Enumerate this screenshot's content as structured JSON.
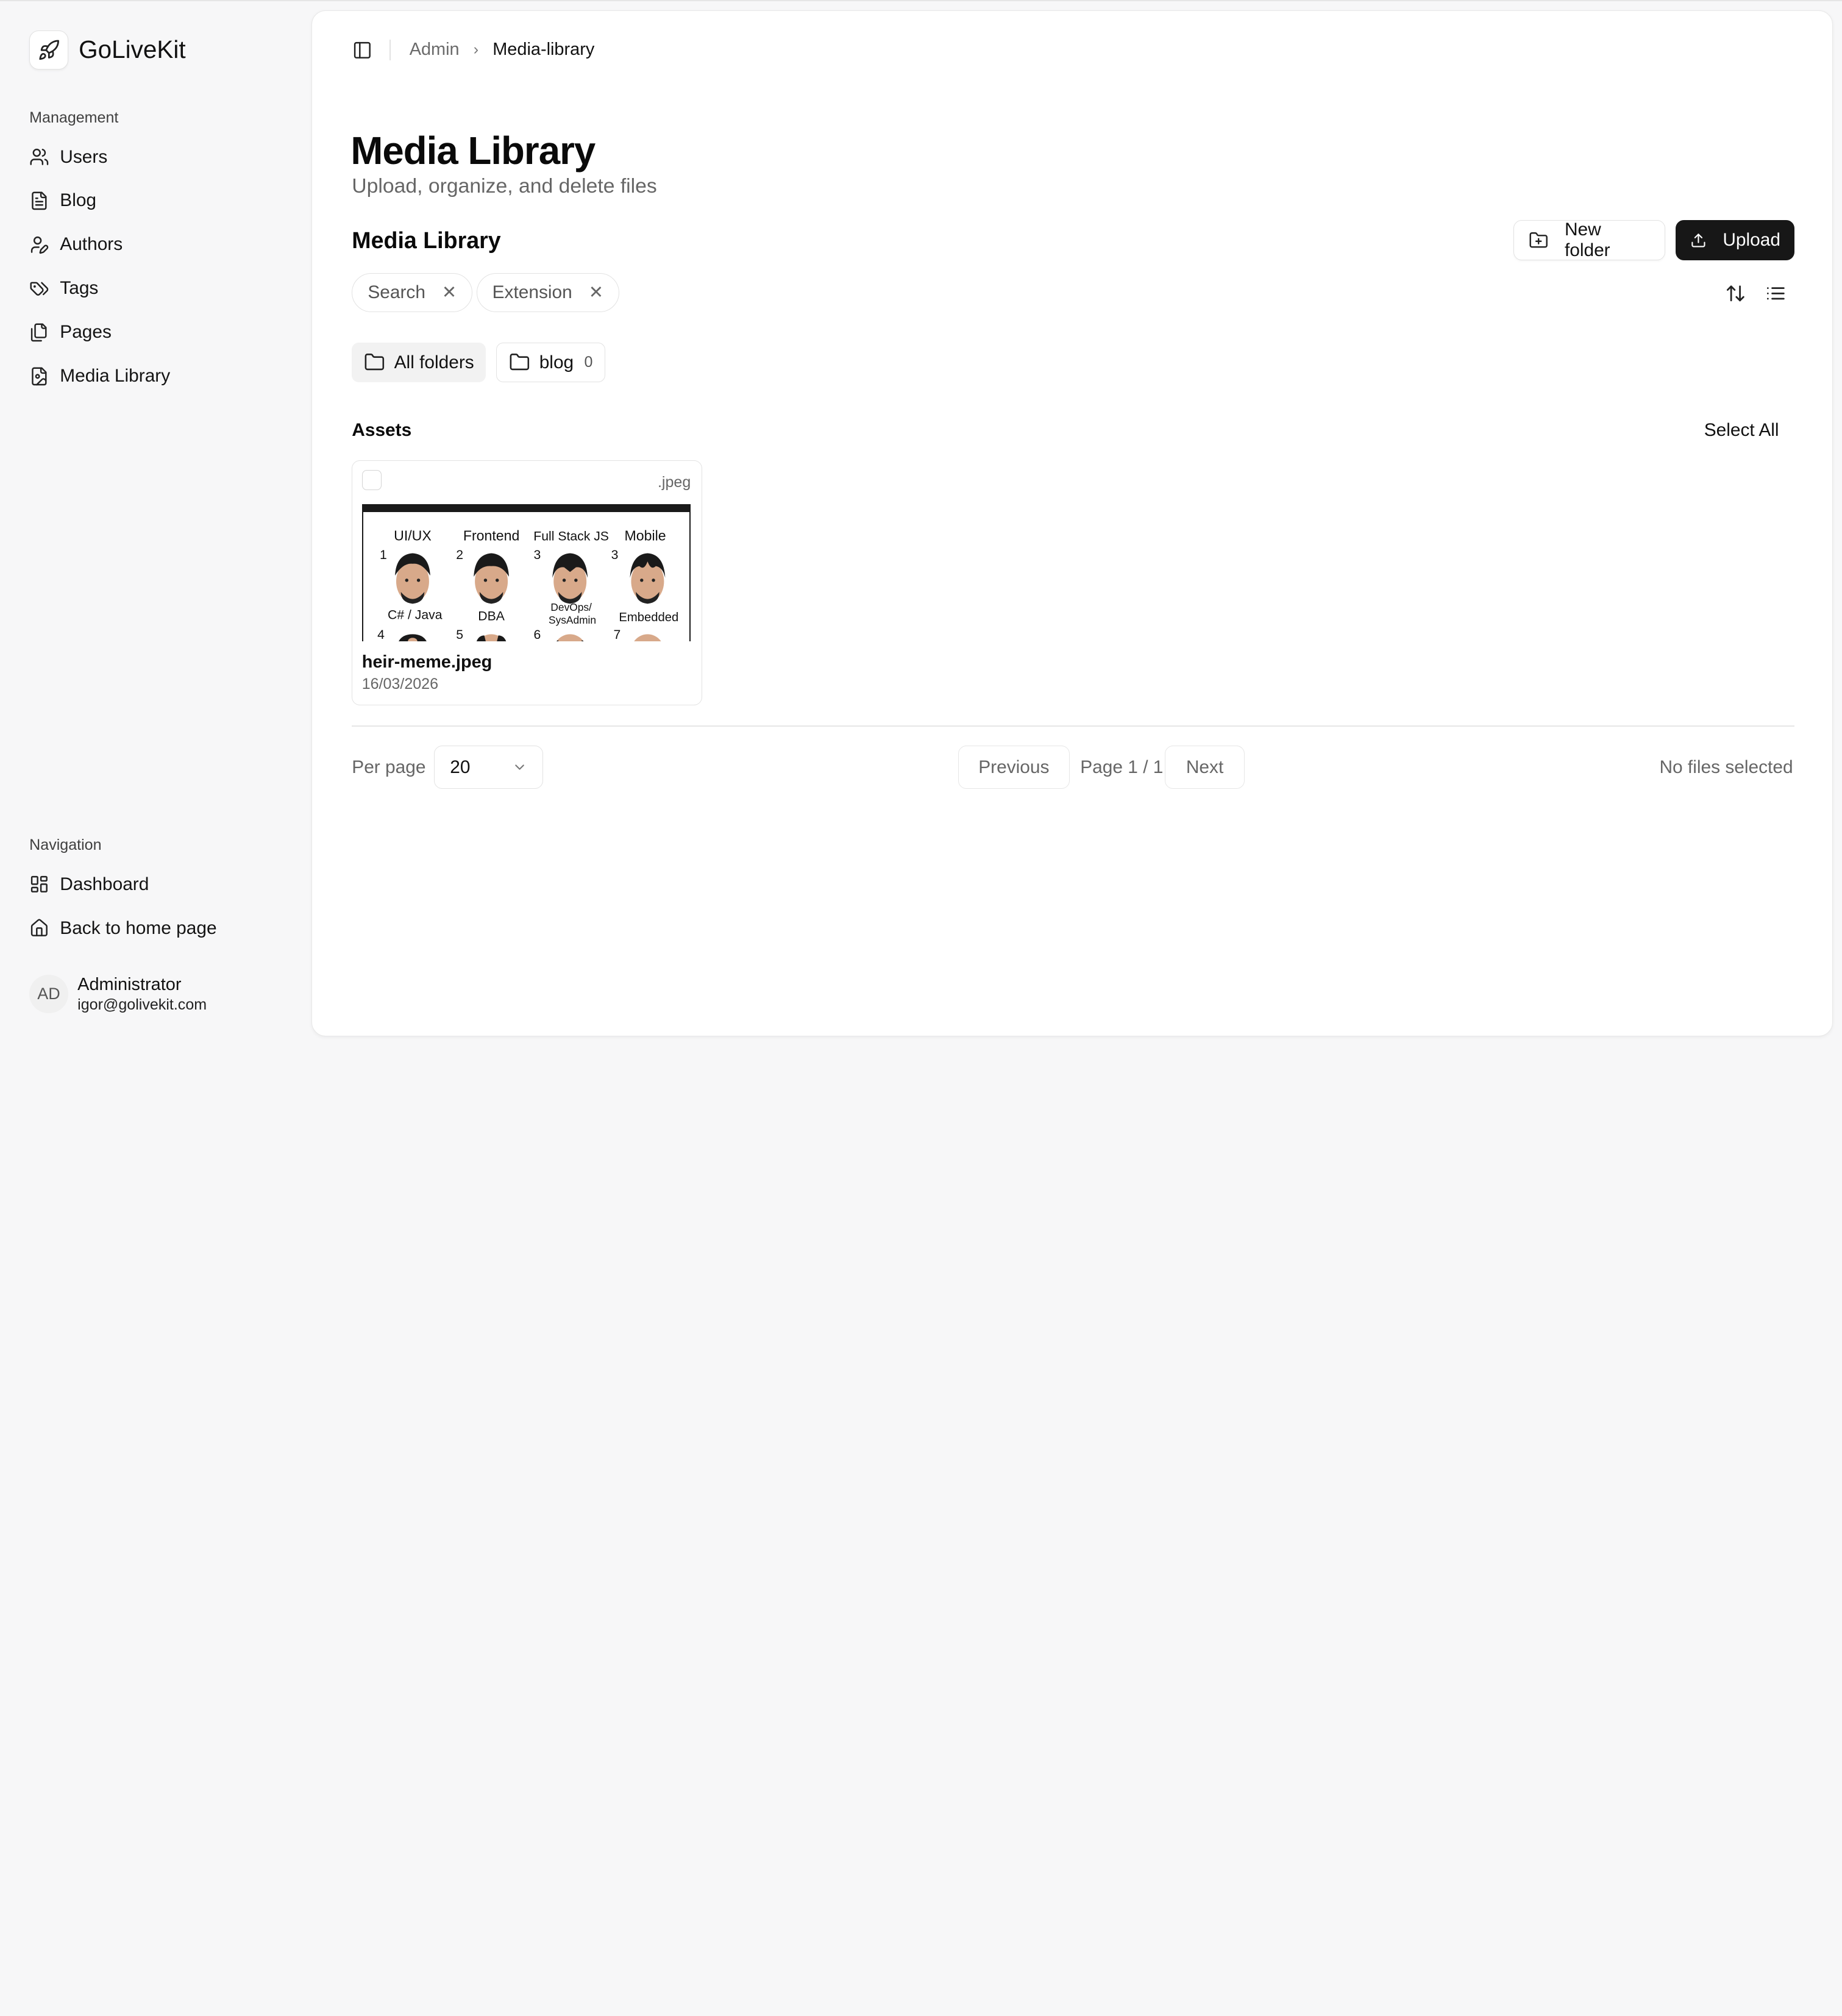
{
  "app": {
    "name": "GoLiveKit"
  },
  "sidebar": {
    "management_label": "Management",
    "management_items": [
      {
        "label": "Users",
        "icon": "users-icon"
      },
      {
        "label": "Blog",
        "icon": "file-text-icon"
      },
      {
        "label": "Authors",
        "icon": "user-pen-icon"
      },
      {
        "label": "Tags",
        "icon": "tags-icon"
      },
      {
        "label": "Pages",
        "icon": "files-icon"
      },
      {
        "label": "Media Library",
        "icon": "file-image-icon"
      }
    ],
    "navigation_label": "Navigation",
    "navigation_items": [
      {
        "label": "Dashboard",
        "icon": "layout-dashboard-icon"
      },
      {
        "label": "Back to home page",
        "icon": "house-icon"
      }
    ],
    "user": {
      "initials": "AD",
      "name": "Administrator",
      "email": "igor@golivekit.com"
    }
  },
  "breadcrumb": {
    "parent": "Admin",
    "current": "Media-library"
  },
  "page": {
    "title": "Media Library",
    "subtitle": "Upload, organize, and delete files"
  },
  "library": {
    "title": "Media Library",
    "new_folder_label": "New folder",
    "upload_label": "Upload",
    "filters": [
      {
        "label": "Search"
      },
      {
        "label": "Extension"
      }
    ],
    "folders": {
      "all_label": "All folders",
      "blog_label": "blog",
      "blog_count": "0"
    },
    "assets_label": "Assets",
    "select_all_label": "Select All",
    "assets": [
      {
        "name": "heir-meme.jpeg",
        "ext": ".jpeg",
        "date": "16/03/2026",
        "thumbnail_texts": {
          "row1": [
            {
              "n": "1",
              "label": "UI/UX"
            },
            {
              "n": "2",
              "label": "Frontend"
            },
            {
              "n": "3",
              "label": "Full Stack JS"
            },
            {
              "n": "3",
              "label": "Mobile"
            }
          ],
          "row2": [
            {
              "n": "4",
              "label": "C# / Java"
            },
            {
              "n": "5",
              "label": "DBA"
            },
            {
              "n": "6",
              "label_line1": "DevOps/",
              "label_line2": "SysAdmin"
            },
            {
              "n": "7",
              "label": "Embedded"
            }
          ]
        }
      }
    ]
  },
  "pagination": {
    "per_page_label": "Per page",
    "per_page_value": "20",
    "previous_label": "Previous",
    "page_info": "Page 1 / 1",
    "next_label": "Next",
    "selection_status": "No files selected"
  },
  "colors": {
    "primary_button": "#171717",
    "background": "#f7f7f8",
    "panel": "#ffffff"
  }
}
